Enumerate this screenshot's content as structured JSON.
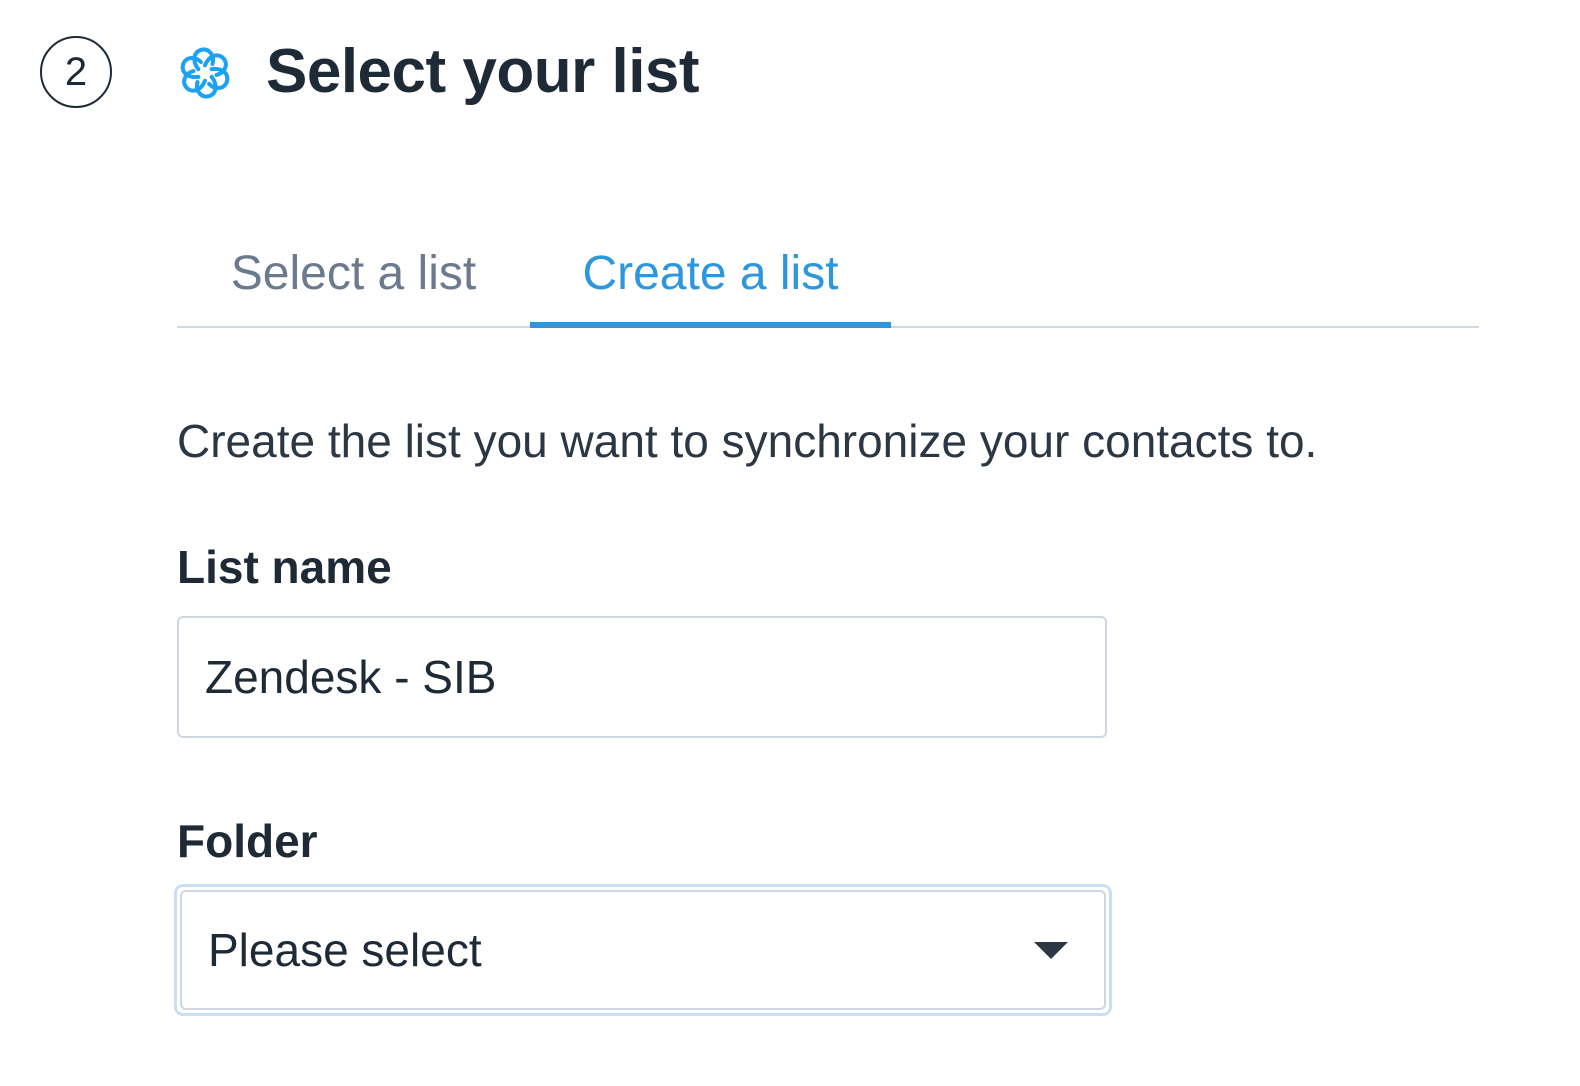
{
  "header": {
    "step_number": "2",
    "title": "Select your list",
    "logo_icon": "sendinblue-swirl-icon",
    "logo_color": "#1da1f2"
  },
  "tabs": [
    {
      "label": "Select a list",
      "active": false
    },
    {
      "label": "Create a list",
      "active": true
    }
  ],
  "colors": {
    "accent": "#2d97dd",
    "text": "#1f2a37",
    "muted": "#6b7a8c",
    "border": "#cfd6df",
    "focus_ring": "#c9dff3"
  },
  "form": {
    "description": "Create the list you want to synchronize your contacts to.",
    "list_name": {
      "label": "List name",
      "value": "Zendesk - SIB"
    },
    "folder": {
      "label": "Folder",
      "selected": "Please select"
    }
  }
}
